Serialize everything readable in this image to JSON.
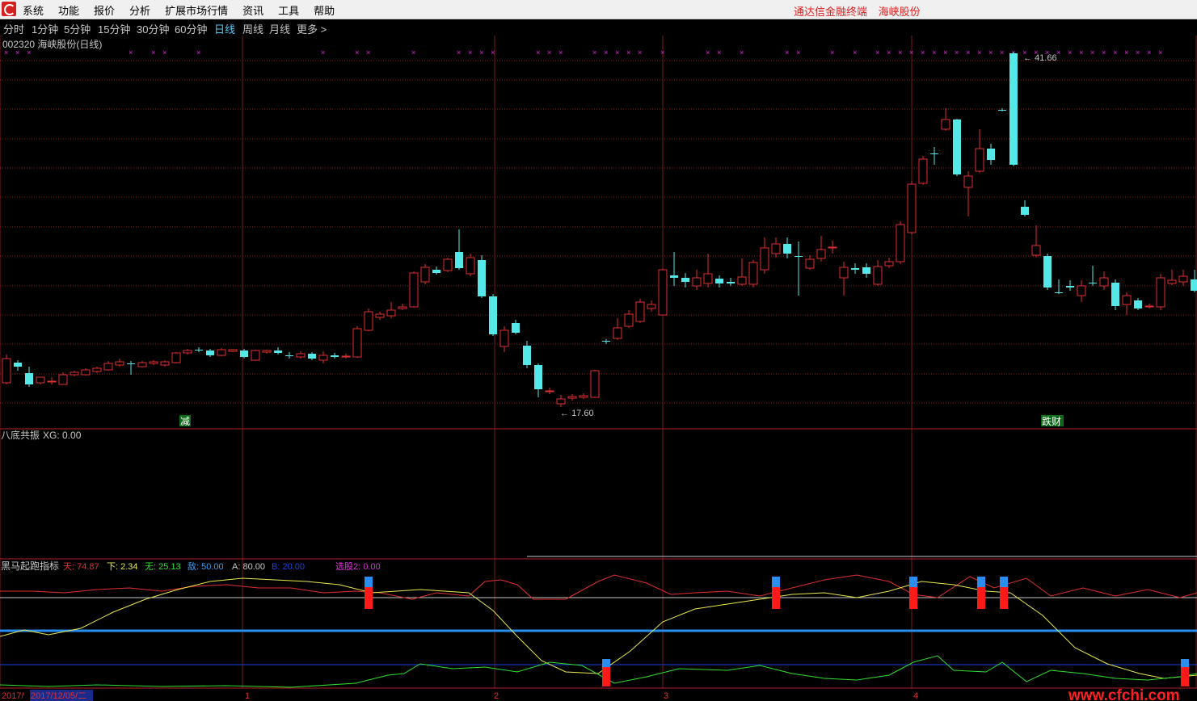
{
  "menu": {
    "items": [
      "系统",
      "功能",
      "报价",
      "分析",
      "扩展市场行情",
      "资讯",
      "工具",
      "帮助"
    ],
    "brand": "通达信金融终端",
    "stock": "海峡股份"
  },
  "periods": [
    "分时",
    "1分钟",
    "5分钟",
    "15分钟",
    "30分钟",
    "60分钟",
    "日线",
    "周线",
    "月线",
    "更多 >"
  ],
  "active_period": "日线",
  "main": {
    "title": "002320 海峡股份(日线)",
    "high_label": "41.66",
    "low_label": "17.60",
    "signal_jian": "减",
    "signal_diecai": "跌财"
  },
  "panel1": {
    "name": "八底共振",
    "xg": "XG: 0.00"
  },
  "panel2": {
    "name": "黑马起跑指标",
    "tian": "天: 74.87",
    "xia": "下: 2.34",
    "wu": "无: 25.13",
    "di": "敌: 50.00",
    "a": "A: 80.00",
    "b": "B: 20.00",
    "xg2": "选股2: 0.00"
  },
  "timeaxis": {
    "start": "2017/",
    "date": "2017/12/05/二",
    "months": [
      "1",
      "2",
      "3",
      "4"
    ]
  },
  "watermark": "www.cfchi.com",
  "colors": {
    "up": "#e03030",
    "down": "#54e8e8",
    "grid": "#8a1e1e",
    "cross": "#e030e0"
  },
  "chart_data": {
    "type": "candlestick",
    "high": 41.66,
    "low": 17.6
  }
}
